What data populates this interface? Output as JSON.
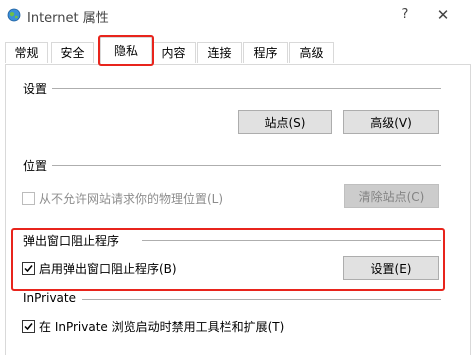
{
  "window": {
    "title": "Internet 属性",
    "help_glyph": "?",
    "close_glyph": "✕",
    "icon": "internet-globe-icon"
  },
  "tabs": [
    {
      "label": "常规",
      "active": false
    },
    {
      "label": "安全",
      "active": false
    },
    {
      "label": "隐私",
      "active": true
    },
    {
      "label": "内容",
      "active": false
    },
    {
      "label": "连接",
      "active": false
    },
    {
      "label": "程序",
      "active": false
    },
    {
      "label": "高级",
      "active": false
    }
  ],
  "settings": {
    "title": "设置",
    "sites_button": "站点(S)",
    "advanced_button": "高级(V)"
  },
  "location": {
    "title": "位置",
    "checkbox_label": "从不允许网站请求你的物理位置(L)",
    "checkbox_checked": false,
    "checkbox_enabled": false,
    "clear_sites_button": "清除站点(C)",
    "clear_sites_enabled": false
  },
  "popup_blocker": {
    "title": "弹出窗口阻止程序",
    "checkbox_label": "启用弹出窗口阻止程序(B)",
    "checkbox_checked": true,
    "settings_button": "设置(E)"
  },
  "inprivate": {
    "title": "InPrivate",
    "checkbox_label": "在 InPrivate 浏览启动时禁用工具栏和扩展(T)",
    "checkbox_checked": true
  },
  "colors": {
    "highlight": "#e8241c",
    "button_bg": "#e1e1e1",
    "disabled_text": "#8d8d8d"
  }
}
